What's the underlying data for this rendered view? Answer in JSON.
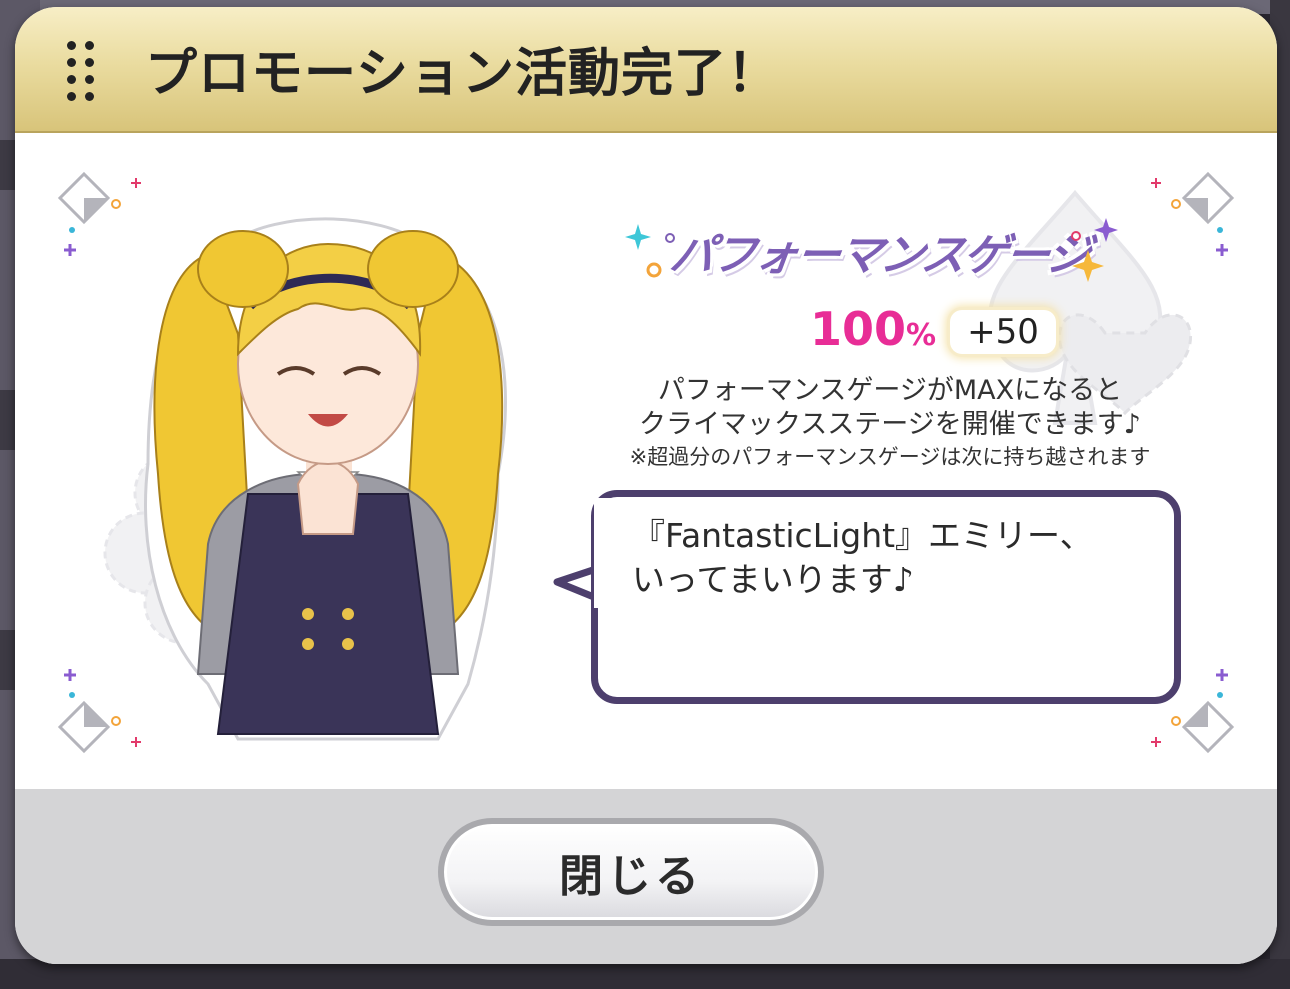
{
  "dialog": {
    "title": "プロモーション活動完了！",
    "drag_icon": "drag-handle-icon"
  },
  "gauge": {
    "label": "パフォーマンスゲージ",
    "percent_value": "100",
    "percent_unit": "%",
    "bonus": "+50"
  },
  "description": {
    "line1": "パフォーマンスゲージがMAXになると",
    "line2": "クライマックスステージを開催できます♪",
    "note": "※超過分のパフォーマンスゲージは次に持ち越されます"
  },
  "speech": {
    "line1": "『FantasticLight』エミリー、",
    "line2": "いってまいります♪"
  },
  "footer": {
    "close_label": "閉じる"
  },
  "colors": {
    "header_gold": "#eadca0",
    "gauge_purple": "#7d5fb5",
    "percent_pink": "#e82d96",
    "bubble_border": "#4d3f6d"
  }
}
